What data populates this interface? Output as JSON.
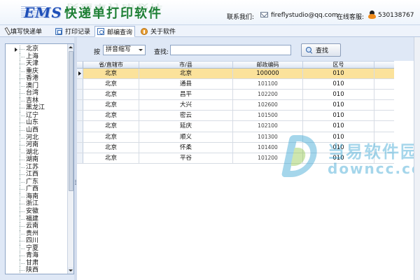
{
  "header": {
    "logo_text": "EMS",
    "app_title": "快递单打印软件",
    "contact_label": "联系我们:",
    "email": "fireflystudio@qq.com",
    "online_service_label": "在线客服:",
    "qq_number": "530138767"
  },
  "toolbar": {
    "items": [
      {
        "label": "填写快递单",
        "icon": "pen-icon"
      },
      {
        "label": "打印记录",
        "icon": "print-record-icon"
      },
      {
        "label": "邮编查询",
        "icon": "zipcode-icon",
        "active": true
      },
      {
        "label": "关于软件",
        "icon": "about-icon"
      }
    ]
  },
  "sidebar": {
    "provinces": [
      "北京",
      "上海",
      "天津",
      "重庆",
      "香港",
      "澳门",
      "台湾",
      "吉林",
      "黑龙江",
      "辽宁",
      "山东",
      "山西",
      "河北",
      "河南",
      "湖北",
      "湖南",
      "江苏",
      "江西",
      "广东",
      "广西",
      "海南",
      "浙江",
      "安徽",
      "福建",
      "云南",
      "贵州",
      "四川",
      "宁夏",
      "青海",
      "甘肃",
      "陕西"
    ]
  },
  "search": {
    "by_label": "按",
    "mode_selected": "拼音缩写",
    "find_label": "查找:",
    "query_value": "",
    "find_button": "查找"
  },
  "table": {
    "columns": [
      "省/直辖市",
      "市/县",
      "邮政编码",
      "区号"
    ],
    "rows": [
      [
        "北京",
        "北京",
        "100000",
        "010"
      ],
      [
        "北京",
        "通县",
        "101100",
        "010"
      ],
      [
        "北京",
        "昌平",
        "102200",
        "010"
      ],
      [
        "北京",
        "大兴",
        "102600",
        "010"
      ],
      [
        "北京",
        "密云",
        "101500",
        "010"
      ],
      [
        "北京",
        "延庆",
        "102100",
        "010"
      ],
      [
        "北京",
        "顺义",
        "101300",
        "010"
      ],
      [
        "北京",
        "怀柔",
        "101400",
        "010"
      ],
      [
        "北京",
        "平谷",
        "101200",
        "010"
      ]
    ],
    "selected_row": 0
  },
  "watermark": {
    "line1": "当易软件园",
    "line2": "downcc.com"
  },
  "colors": {
    "selected_row": "#fbe29b",
    "logo_blue": "#1f4fb8",
    "title_green": "#1d7f34"
  }
}
